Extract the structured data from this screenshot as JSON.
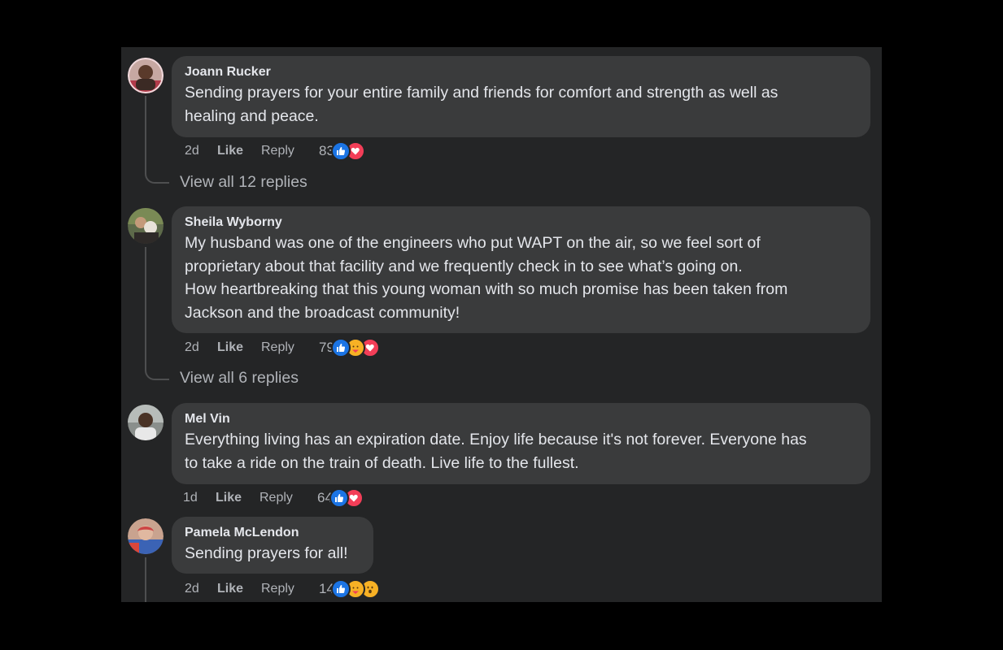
{
  "comments": [
    {
      "author": "Joann Rucker",
      "lines": [
        "Sending prayers for your entire family and friends for comfort and strength as well as",
        "healing and peace."
      ],
      "time": "2d",
      "like_label": "Like",
      "reply_label": "Reply",
      "reaction_count": "83",
      "reactions": [
        "like-icon",
        "love-icon"
      ],
      "view_replies": "View all 12 replies"
    },
    {
      "author": "Sheila Wyborny",
      "lines": [
        "My husband was one of the engineers who put WAPT on the air, so we feel sort of",
        "proprietary about that facility and we frequently check in to see what’s going on.",
        "How heartbreaking that this young woman with so much promise has been taken from",
        "Jackson and the broadcast community!"
      ],
      "time": "2d",
      "like_label": "Like",
      "reply_label": "Reply",
      "reaction_count": "79",
      "reactions": [
        "like-icon",
        "care-icon",
        "love-icon"
      ],
      "view_replies": "View all 6 replies"
    },
    {
      "author": "Mel Vin",
      "lines": [
        "Everything living has an expiration date. Enjoy life because it's not forever. Everyone has",
        "to take a ride on the train of death. Live life to the fullest."
      ],
      "time": "1d",
      "like_label": "Like",
      "reply_label": "Reply",
      "reaction_count": "64",
      "reactions": [
        "like-icon",
        "love-icon"
      ]
    },
    {
      "author": "Pamela McLendon",
      "lines": [
        "Sending prayers for all!"
      ],
      "time": "2d",
      "like_label": "Like",
      "reply_label": "Reply",
      "reaction_count": "14",
      "reactions": [
        "like-icon",
        "care-icon",
        "wow-icon"
      ]
    }
  ],
  "colors": {
    "background": "#242526",
    "bubble": "#3a3b3c",
    "text": "#e4e6eb",
    "secondary_text": "#b0b3b8",
    "like_blue": "#1b74e4",
    "love_red": "#f33e58",
    "care_yellow": "#f7b125"
  }
}
